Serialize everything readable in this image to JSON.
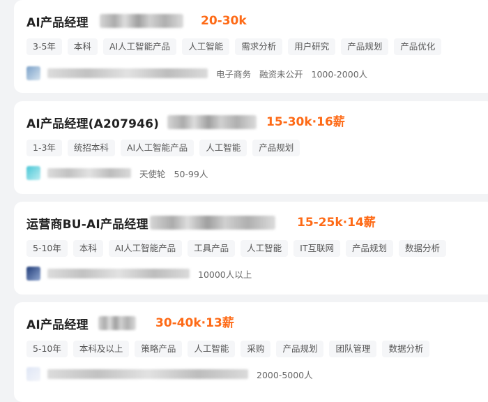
{
  "jobs": [
    {
      "title": "AI产品经理",
      "salary": "20-30k",
      "tags": [
        "3-5年",
        "本科",
        "AI人工智能产品",
        "人工智能",
        "需求分析",
        "用户研究",
        "产品规划",
        "产品优化"
      ],
      "company_info": [
        "电子商务",
        "融资未公开",
        "1000-2000人"
      ]
    },
    {
      "title": "AI产品经理(A207946)",
      "salary": "15-30k·16薪",
      "tags": [
        "1-3年",
        "统招本科",
        "AI人工智能产品",
        "人工智能",
        "产品规划"
      ],
      "company_info": [
        "天使轮",
        "50-99人"
      ]
    },
    {
      "title": "运营商BU-AI产品经理",
      "salary": "15-25k·14薪",
      "tags": [
        "5-10年",
        "本科",
        "AI人工智能产品",
        "工具产品",
        "人工智能",
        "IT互联网",
        "产品规划",
        "数据分析"
      ],
      "company_info": [
        "10000人以上"
      ]
    },
    {
      "title": "AI产品经理",
      "salary": "30-40k·13薪",
      "tags": [
        "5-10年",
        "本科及以上",
        "策略产品",
        "人工智能",
        "采购",
        "产品规划",
        "团队管理",
        "数据分析"
      ],
      "company_info": [
        "2000-5000人"
      ]
    }
  ],
  "colors": {
    "salary": "#fe6a16",
    "tag_bg": "#f5f6f8",
    "page_bg": "#f2f3f5"
  }
}
